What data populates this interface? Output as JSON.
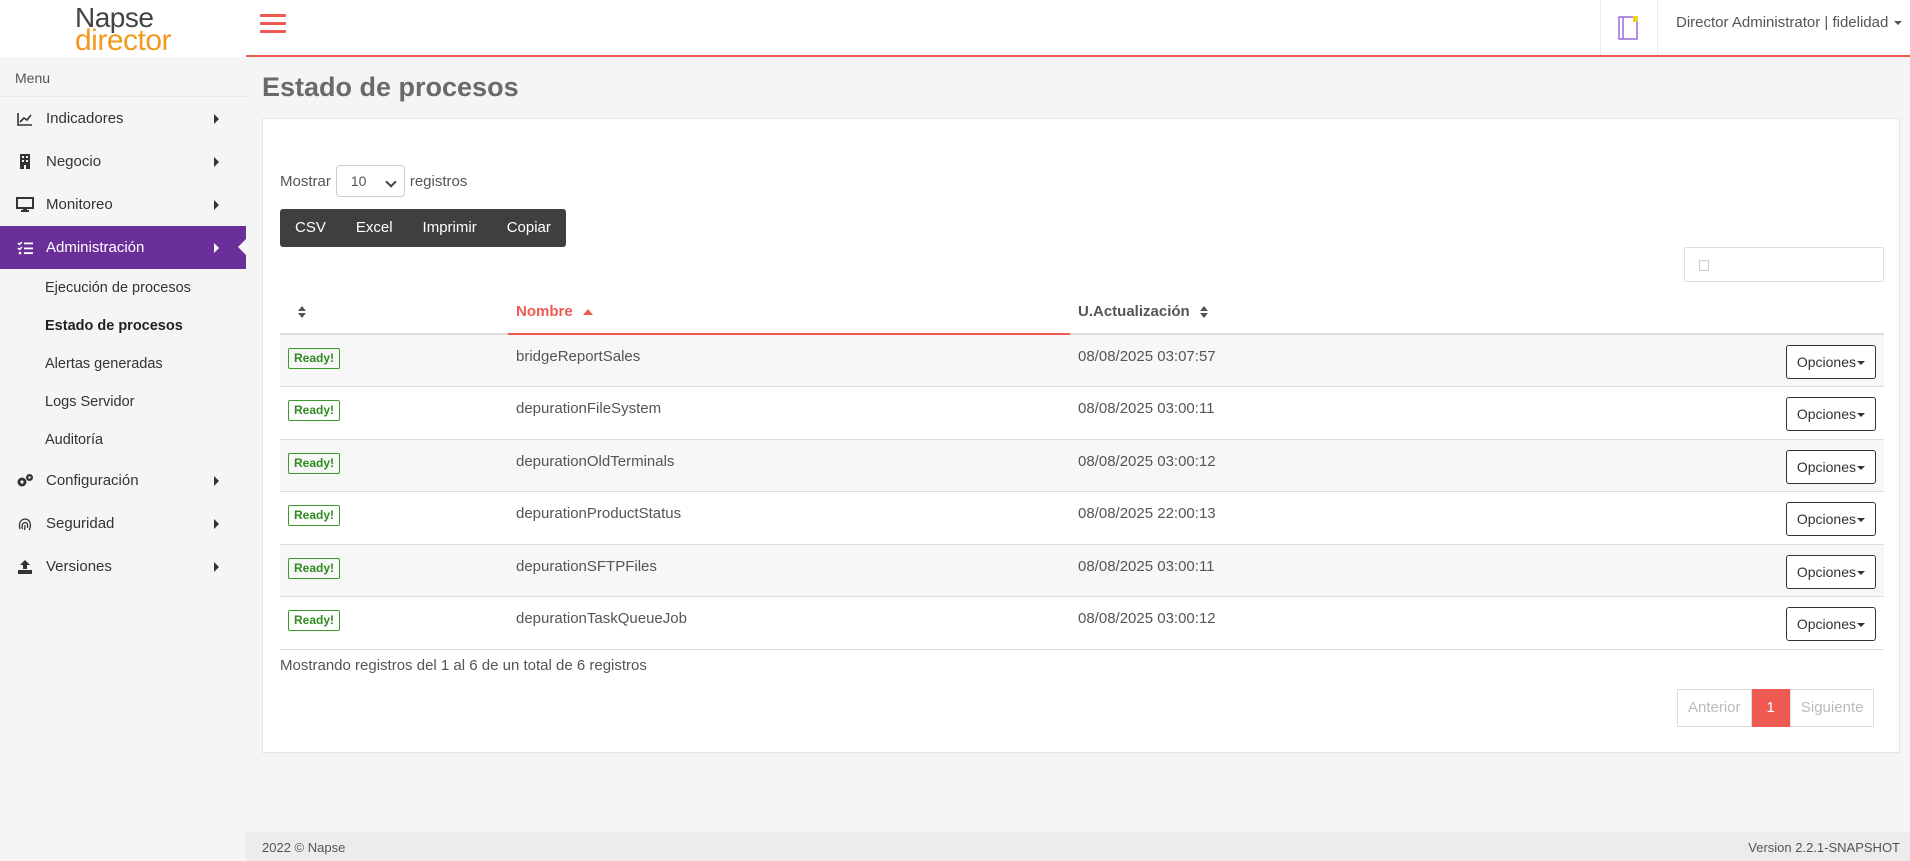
{
  "brand": {
    "line1": "Napse",
    "line2": "director"
  },
  "header": {
    "user": "Director Administrator | fidelidad"
  },
  "sidebar": {
    "menu_title": "Menu",
    "items": [
      {
        "label": "Indicadores",
        "icon": "chart-line-icon"
      },
      {
        "label": "Negocio",
        "icon": "building-icon"
      },
      {
        "label": "Monitoreo",
        "icon": "desktop-icon"
      },
      {
        "label": "Administración",
        "icon": "tasks-icon"
      },
      {
        "label": "Configuración",
        "icon": "gears-icon"
      },
      {
        "label": "Seguridad",
        "icon": "fingerprint-icon"
      },
      {
        "label": "Versiones",
        "icon": "upload-icon"
      }
    ],
    "subitems": [
      {
        "label": "Ejecución de procesos"
      },
      {
        "label": "Estado de procesos"
      },
      {
        "label": "Alertas generadas"
      },
      {
        "label": "Logs Servidor"
      },
      {
        "label": "Auditoría"
      }
    ]
  },
  "page": {
    "title": "Estado de procesos"
  },
  "table_controls": {
    "show_label": "Mostrar",
    "page_size": "10",
    "records_label": "registros",
    "export_buttons": [
      "CSV",
      "Excel",
      "Imprimir",
      "Copiar"
    ]
  },
  "table": {
    "headers": [
      "",
      "Nombre",
      "U.Actualización"
    ],
    "rows": [
      {
        "status": "Ready!",
        "name": "bridgeReportSales",
        "updated": "08/08/2025 03:07:57",
        "action": "Opciones"
      },
      {
        "status": "Ready!",
        "name": "depurationFileSystem",
        "updated": "08/08/2025 03:00:11",
        "action": "Opciones"
      },
      {
        "status": "Ready!",
        "name": "depurationOldTerminals",
        "updated": "08/08/2025 03:00:12",
        "action": "Opciones"
      },
      {
        "status": "Ready!",
        "name": "depurationProductStatus",
        "updated": "08/08/2025 22:00:13",
        "action": "Opciones"
      },
      {
        "status": "Ready!",
        "name": "depurationSFTPFiles",
        "updated": "08/08/2025 03:00:11",
        "action": "Opciones"
      },
      {
        "status": "Ready!",
        "name": "depurationTaskQueueJob",
        "updated": "08/08/2025 03:00:12",
        "action": "Opciones"
      }
    ]
  },
  "info": "Mostrando registros del 1 al 6 de un total de 6 registros",
  "pagination": {
    "prev": "Anterior",
    "current": "1",
    "next": "Siguiente"
  },
  "footer": {
    "copyright": "2022 © Napse",
    "version": "Version 2.2.1-SNAPSHOT"
  },
  "colors": {
    "accent": "#ee5a52",
    "active_nav": "#6a2f99",
    "logo_orange": "#f29a1f",
    "ready_green": "#2e8b1e"
  }
}
